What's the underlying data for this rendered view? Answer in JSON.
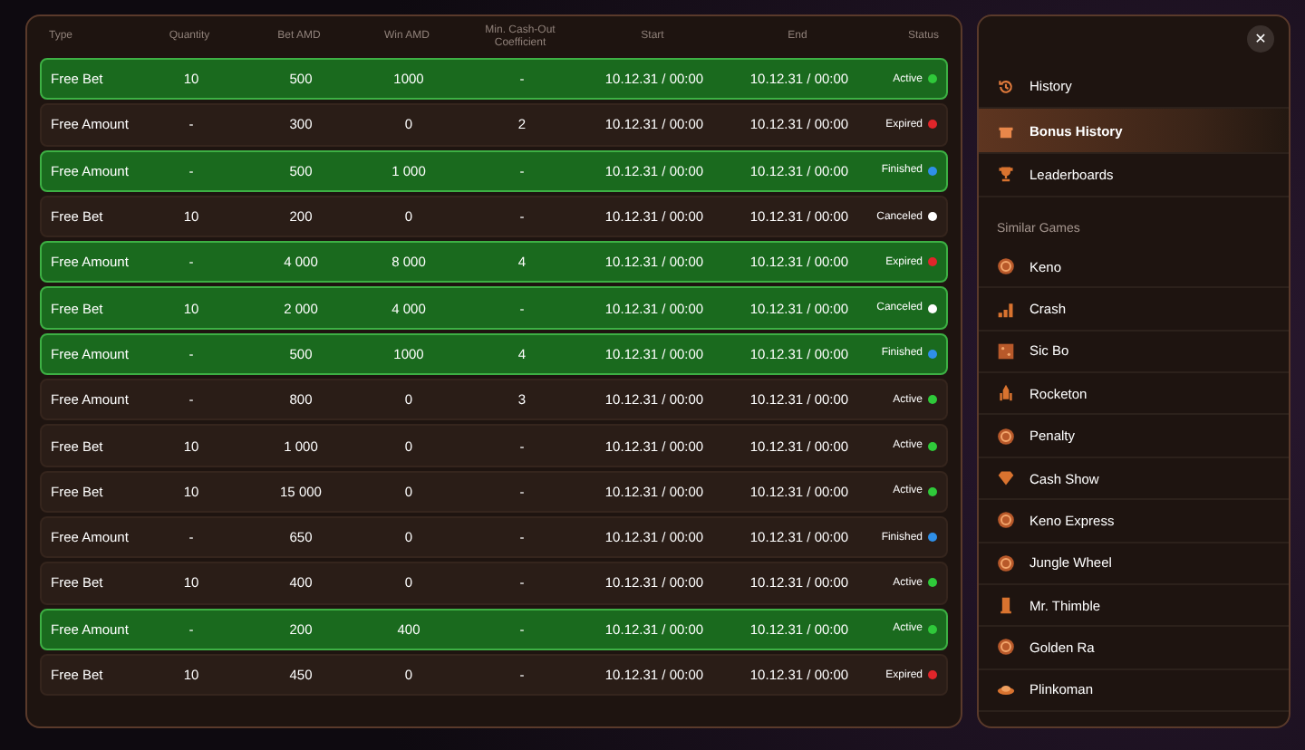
{
  "table": {
    "columns": [
      "Type",
      "Quantity",
      "Bet AMD",
      "Win AMD",
      "Min. Cash-Out Coefficient",
      "Start",
      "End",
      "Status"
    ],
    "rows": [
      {
        "type": "Free Bet",
        "quantity": "10",
        "bet": "500",
        "win": "1000",
        "coefficient": "-",
        "start": "10.12.31 / 00:00",
        "end": "10.12.31 / 00:00",
        "status": "Active",
        "color": "#2fc93a",
        "highlighted": true
      },
      {
        "type": "Free Amount",
        "quantity": "-",
        "bet": "300",
        "win": "0",
        "coefficient": "2",
        "start": "10.12.31 / 00:00",
        "end": "10.12.31 / 00:00",
        "status": "Expired",
        "color": "#e0252a",
        "highlighted": false
      },
      {
        "type": "Free Amount",
        "quantity": "-",
        "bet": "500",
        "win": "1 000",
        "coefficient": "-",
        "start": "10.12.31 / 00:00",
        "end": "10.12.31 / 00:00",
        "status": "Finished",
        "color": "#2f8fe8",
        "highlighted": true
      },
      {
        "type": "Free Bet",
        "quantity": "10",
        "bet": "200",
        "win": "0",
        "coefficient": "-",
        "start": "10.12.31 / 00:00",
        "end": "10.12.31 / 00:00",
        "status": "Canceled",
        "color": "#ffffff",
        "highlighted": false
      },
      {
        "type": "Free Amount",
        "quantity": "-",
        "bet": "4 000",
        "win": "8 000",
        "coefficient": "4",
        "start": "10.12.31 / 00:00",
        "end": "10.12.31 / 00:00",
        "status": "Expired",
        "color": "#e0252a",
        "highlighted": true
      },
      {
        "type": "Free Bet",
        "quantity": "10",
        "bet": "2 000",
        "win": "4 000",
        "coefficient": "-",
        "start": "10.12.31 / 00:00",
        "end": "10.12.31 / 00:00",
        "status": "Canceled",
        "color": "#ffffff",
        "highlighted": true
      },
      {
        "type": "Free Amount",
        "quantity": "-",
        "bet": "500",
        "win": "1000",
        "coefficient": "4",
        "start": "10.12.31 / 00:00",
        "end": "10.12.31 / 00:00",
        "status": "Finished",
        "color": "#2f8fe8",
        "highlighted": true
      },
      {
        "type": "Free Amount",
        "quantity": "-",
        "bet": "800",
        "win": "0",
        "coefficient": "3",
        "start": "10.12.31 / 00:00",
        "end": "10.12.31 / 00:00",
        "status": "Active",
        "color": "#2fc93a",
        "highlighted": false
      },
      {
        "type": "Free Bet",
        "quantity": "10",
        "bet": "1 000",
        "win": "0",
        "coefficient": "-",
        "start": "10.12.31 / 00:00",
        "end": "10.12.31 / 00:00",
        "status": "Active",
        "color": "#2fc93a",
        "highlighted": false
      },
      {
        "type": "Free Bet",
        "quantity": "10",
        "bet": "15 000",
        "win": "0",
        "coefficient": "-",
        "start": "10.12.31 / 00:00",
        "end": "10.12.31 / 00:00",
        "status": "Active",
        "color": "#2fc93a",
        "highlighted": false
      },
      {
        "type": "Free Amount",
        "quantity": "-",
        "bet": "650",
        "win": "0",
        "coefficient": "-",
        "start": "10.12.31 / 00:00",
        "end": "10.12.31 / 00:00",
        "status": "Finished",
        "color": "#2f8fe8",
        "highlighted": false
      },
      {
        "type": "Free Bet",
        "quantity": "10",
        "bet": "400",
        "win": "0",
        "coefficient": "-",
        "start": "10.12.31 / 00:00",
        "end": "10.12.31 / 00:00",
        "status": "Active",
        "color": "#2fc93a",
        "highlighted": false
      },
      {
        "type": "Free Amount",
        "quantity": "-",
        "bet": "200",
        "win": "400",
        "coefficient": "-",
        "start": "10.12.31 / 00:00",
        "end": "10.12.31 / 00:00",
        "status": "Active",
        "color": "#2fc93a",
        "highlighted": true
      },
      {
        "type": "Free Bet",
        "quantity": "10",
        "bet": "450",
        "win": "0",
        "coefficient": "-",
        "start": "10.12.31 / 00:00",
        "end": "10.12.31 / 00:00",
        "status": "Expired",
        "color": "#e0252a",
        "highlighted": false
      }
    ]
  },
  "sidebar": {
    "close": "✕",
    "items": [
      {
        "label": "History",
        "selected": false
      },
      {
        "label": "Bonus History",
        "selected": true
      },
      {
        "label": "Leaderboards",
        "selected": false
      }
    ],
    "section_title": "Similar Games",
    "games": [
      "Keno",
      "Crash",
      "Sic Bo",
      "Rocketon",
      "Penalty",
      "Cash Show",
      "Keno Express",
      "Jungle Wheel",
      "Mr. Thimble",
      "Golden Ra",
      "Plinkoman"
    ]
  }
}
